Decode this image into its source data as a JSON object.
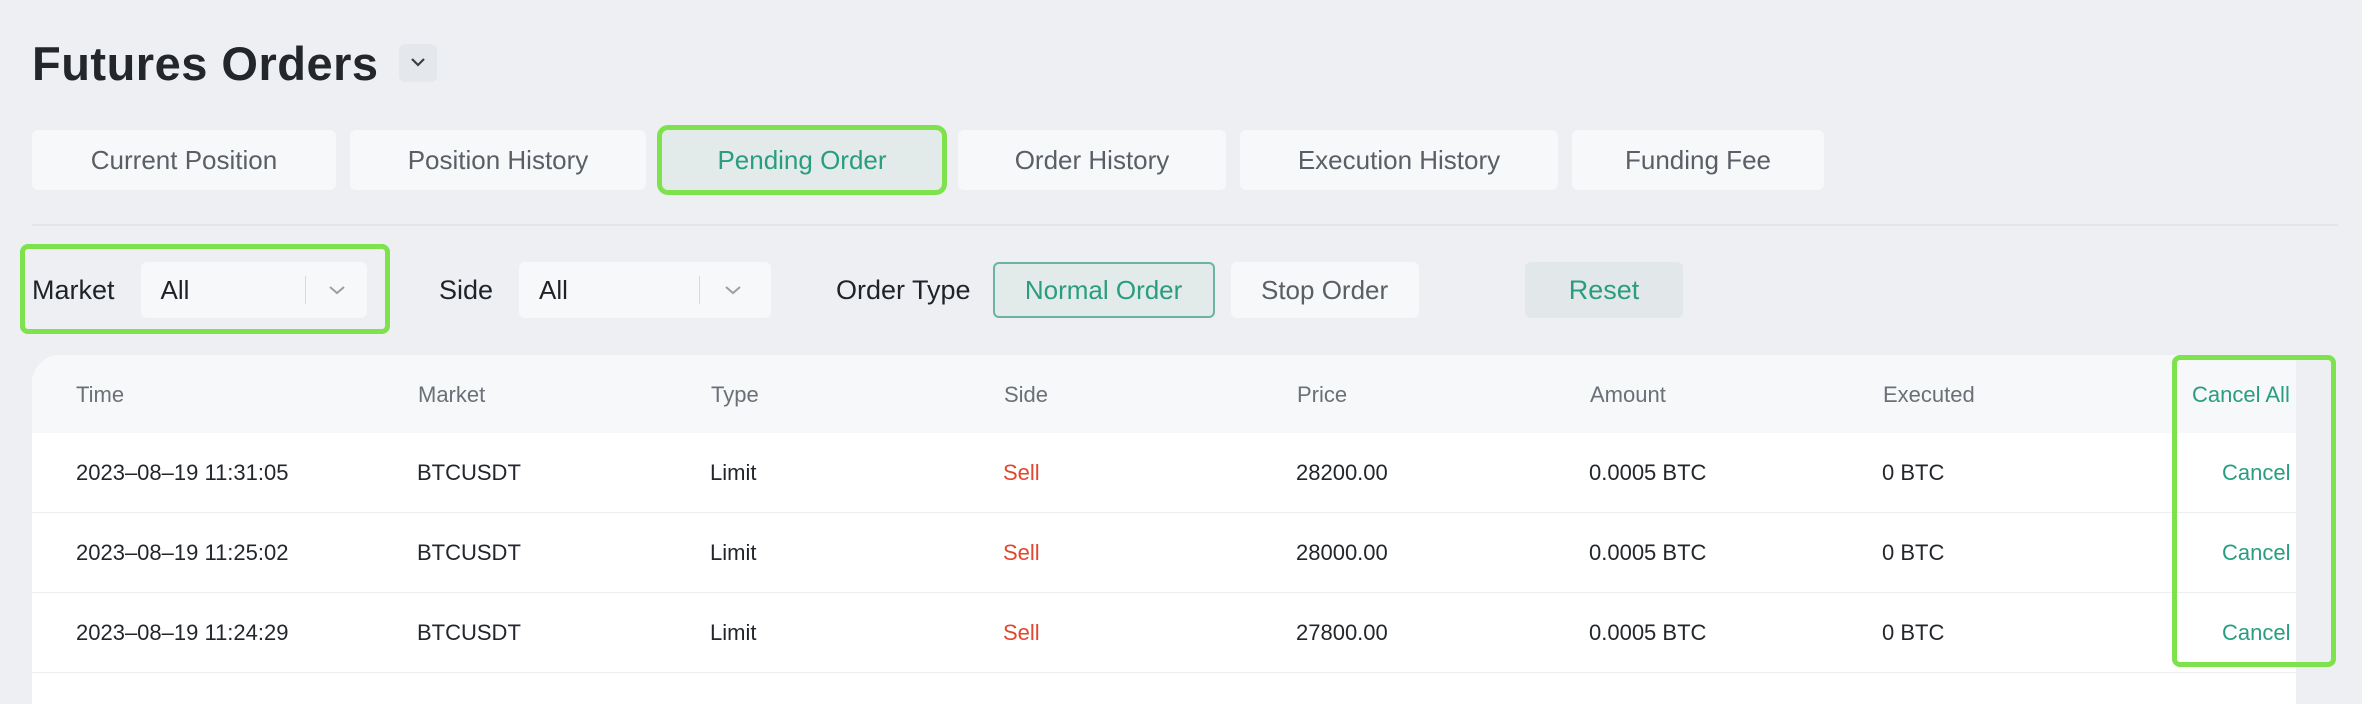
{
  "header": {
    "title": "Futures Orders",
    "dropdown_icon": "chevron-down-icon"
  },
  "tabs": [
    {
      "label": "Current Position",
      "active": false
    },
    {
      "label": "Position History",
      "active": false
    },
    {
      "label": "Pending Order",
      "active": true
    },
    {
      "label": "Order History",
      "active": false
    },
    {
      "label": "Execution History",
      "active": false
    },
    {
      "label": "Funding Fee",
      "active": false
    }
  ],
  "filters": {
    "market_label": "Market",
    "market_value": "All",
    "side_label": "Side",
    "side_value": "All",
    "order_type_label": "Order Type",
    "normal_order": "Normal Order",
    "stop_order": "Stop Order",
    "reset": "Reset"
  },
  "table": {
    "columns": [
      "Time",
      "Market",
      "Type",
      "Side",
      "Price",
      "Amount",
      "Executed"
    ],
    "cancel_all": "Cancel All",
    "rows": [
      {
        "time": "2023–08–19 11:31:05",
        "market": "BTCUSDT",
        "type": "Limit",
        "side": "Sell",
        "price": "28200.00",
        "amount": "0.0005 BTC",
        "executed": "0 BTC",
        "action": "Cancel"
      },
      {
        "time": "2023–08–19 11:25:02",
        "market": "BTCUSDT",
        "type": "Limit",
        "side": "Sell",
        "price": "28000.00",
        "amount": "0.0005 BTC",
        "executed": "0 BTC",
        "action": "Cancel"
      },
      {
        "time": "2023–08–19 11:24:29",
        "market": "BTCUSDT",
        "type": "Limit",
        "side": "Sell",
        "price": "27800.00",
        "amount": "0.0005 BTC",
        "executed": "0 BTC",
        "action": "Cancel"
      }
    ]
  },
  "colors": {
    "accent": "#2a9d80",
    "sell": "#e0482d",
    "highlight": "#7de24b"
  }
}
